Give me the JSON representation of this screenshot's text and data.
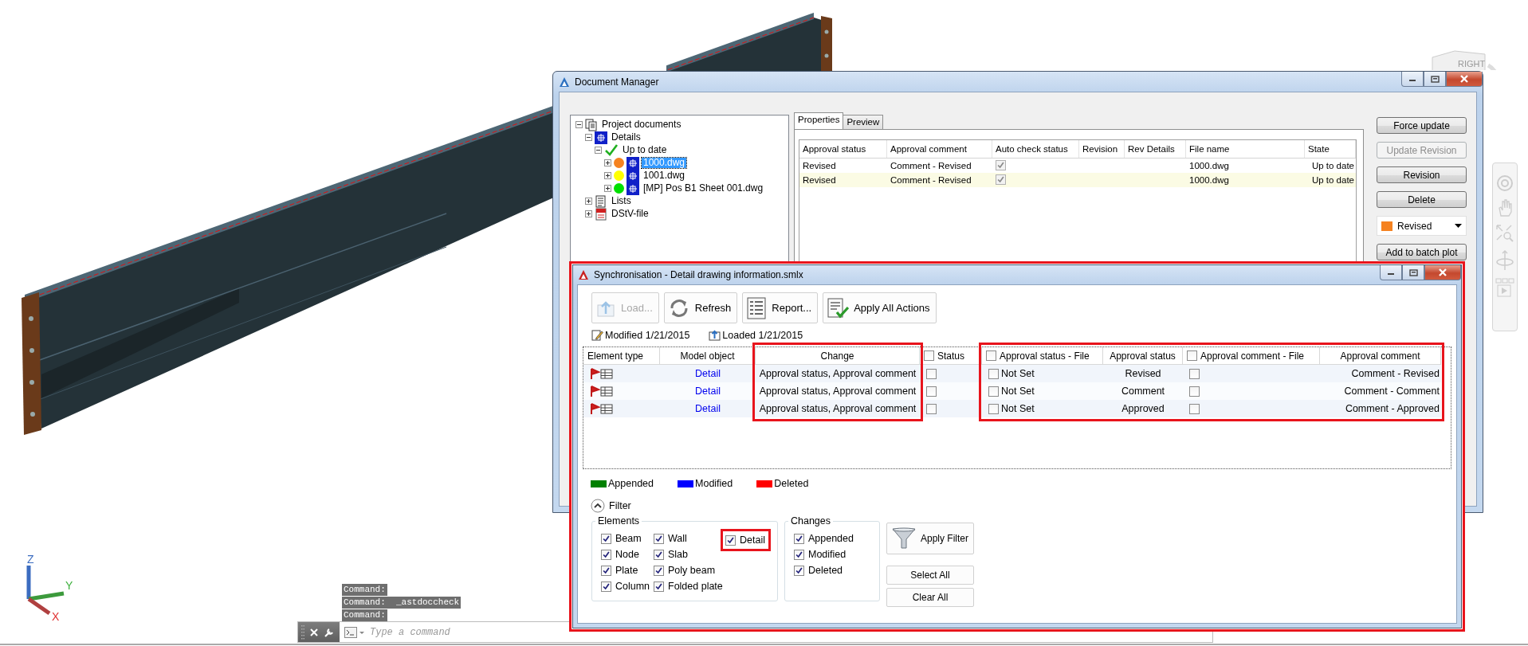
{
  "viewport": {
    "viewcube_label": "RIGHT",
    "axis_labels": {
      "x": "X",
      "y": "Y",
      "z": "Z"
    },
    "command_history": [
      "Command:",
      "Command:  _astdoccheck",
      "Command:"
    ],
    "command_line": {
      "placeholder": "Type a command"
    }
  },
  "document_manager": {
    "title": "Document Manager",
    "tree": [
      {
        "label": "Project documents",
        "kind": "documents",
        "expanded": true,
        "selected": false,
        "children": [
          {
            "label": "Details",
            "kind": "details",
            "expanded": true,
            "selected": false,
            "children": [
              {
                "label": "Up to date",
                "kind": "status",
                "expanded": true,
                "selected": false,
                "children": [
                  {
                    "label": "1000.dwg",
                    "kind": "drawing",
                    "color": "#f58220",
                    "expanded": false,
                    "selected": true
                  },
                  {
                    "label": "1001.dwg",
                    "kind": "drawing",
                    "color": "#ffff00",
                    "expanded": false,
                    "selected": false
                  },
                  {
                    "label": "[MP] Pos B1 Sheet 001.dwg",
                    "kind": "drawing",
                    "color": "#00e000",
                    "expanded": false,
                    "selected": false
                  }
                ]
              }
            ]
          },
          {
            "label": "Lists",
            "kind": "lists",
            "expanded": false,
            "selected": false
          },
          {
            "label": "DStV-file",
            "kind": "dstv",
            "expanded": false,
            "selected": false
          }
        ]
      }
    ],
    "tabs": [
      {
        "label": "Properties",
        "selected": true
      },
      {
        "label": "Preview",
        "selected": false
      }
    ],
    "properties": {
      "columns": [
        "Approval status",
        "Approval comment",
        "Auto check status",
        "Revision",
        "Rev Details",
        "File name",
        "State"
      ],
      "rows": [
        {
          "approval_status": "Revised",
          "approval_comment": "Comment - Revised",
          "auto_check": true,
          "file_name": "1000.dwg",
          "state": "Up to date",
          "selected": false
        },
        {
          "approval_status": "Revised",
          "approval_comment": "Comment - Revised",
          "auto_check": true,
          "file_name": "1000.dwg",
          "state": "Up to date",
          "selected": true
        }
      ]
    },
    "buttons": [
      {
        "label": "Force update",
        "disabled": false
      },
      {
        "label": "Update Revision",
        "disabled": true
      },
      {
        "label": "Revision",
        "disabled": false
      },
      {
        "label": "Delete",
        "disabled": false
      }
    ],
    "status_dropdown": {
      "value": "Revised",
      "color": "#f58220"
    },
    "batch_button": {
      "label": "Add to batch plot",
      "disabled": false
    }
  },
  "synchronisation": {
    "title": "Synchronisation - Detail drawing information.smlx",
    "toolbar": [
      {
        "label": "Load...",
        "kind": "load",
        "disabled": true
      },
      {
        "label": "Refresh",
        "kind": "refresh",
        "disabled": false
      },
      {
        "label": "Report...",
        "kind": "report",
        "disabled": false
      },
      {
        "label": "Apply All Actions",
        "kind": "apply",
        "disabled": false
      }
    ],
    "info": [
      {
        "kind": "modified",
        "text": "Modified 1/21/2015"
      },
      {
        "kind": "loaded",
        "text": "Loaded 1/21/2015"
      }
    ],
    "table": {
      "columns": [
        {
          "label": "Element type",
          "kind": "plain",
          "highlighted": false
        },
        {
          "label": "Model object",
          "kind": "plain",
          "highlighted": false
        },
        {
          "label": "Change",
          "kind": "plain",
          "highlighted": true
        },
        {
          "label": "Status",
          "kind": "check",
          "checked": false,
          "highlighted": false
        },
        {
          "label": "Approval status - File",
          "kind": "check",
          "checked": false,
          "highlighted": true
        },
        {
          "label": "Approval status",
          "kind": "plain",
          "highlighted": true
        },
        {
          "label": "Approval comment - File",
          "kind": "check",
          "checked": false,
          "highlighted": true
        },
        {
          "label": "Approval comment",
          "kind": "plain",
          "highlighted": true
        }
      ],
      "rows": [
        {
          "model_object": "Detail",
          "change": "Approval status, Approval comment",
          "status_checked": false,
          "approval_status_file_checked": false,
          "approval_status_file": "Not Set",
          "approval_status": "Revised",
          "approval_comment_file_checked": false,
          "approval_comment": "Comment - Revised"
        },
        {
          "model_object": "Detail",
          "change": "Approval status, Approval comment",
          "status_checked": false,
          "approval_status_file_checked": false,
          "approval_status_file": "Not Set",
          "approval_status": "Comment",
          "approval_comment_file_checked": false,
          "approval_comment": "Comment - Comment"
        },
        {
          "model_object": "Detail",
          "change": "Approval status, Approval comment",
          "status_checked": false,
          "approval_status_file_checked": false,
          "approval_status_file": "Not Set",
          "approval_status": "Approved",
          "approval_comment_file_checked": false,
          "approval_comment": "Comment - Approved"
        }
      ]
    },
    "legend": [
      {
        "label": "Appended",
        "color": "#008000"
      },
      {
        "label": "Modified",
        "color": "#0000ff"
      },
      {
        "label": "Deleted",
        "color": "#ff0000"
      }
    ],
    "filter": {
      "label": "Filter",
      "expanded": true,
      "groups": [
        {
          "title": "Elements",
          "kind": "elements",
          "items": [
            {
              "label": "Beam",
              "checked": true,
              "highlighted": false
            },
            {
              "label": "Node",
              "checked": true,
              "highlighted": false
            },
            {
              "label": "Plate",
              "checked": true,
              "highlighted": false
            },
            {
              "label": "Column",
              "checked": true,
              "highlighted": false
            },
            {
              "label": "Wall",
              "checked": true,
              "highlighted": false
            },
            {
              "label": "Slab",
              "checked": true,
              "highlighted": false
            },
            {
              "label": "Poly beam",
              "checked": true,
              "highlighted": false
            },
            {
              "label": "Folded plate",
              "checked": true,
              "highlighted": false
            },
            {
              "label": "Detail",
              "checked": true,
              "highlighted": true
            }
          ]
        },
        {
          "title": "Changes",
          "kind": "changes",
          "items": [
            {
              "label": "Appended",
              "checked": true,
              "highlighted": false
            },
            {
              "label": "Modified",
              "checked": true,
              "highlighted": false
            },
            {
              "label": "Deleted",
              "checked": true,
              "highlighted": false
            }
          ]
        }
      ],
      "apply_button": "Apply Filter",
      "buttons": [
        "Select All",
        "Clear All"
      ]
    }
  }
}
